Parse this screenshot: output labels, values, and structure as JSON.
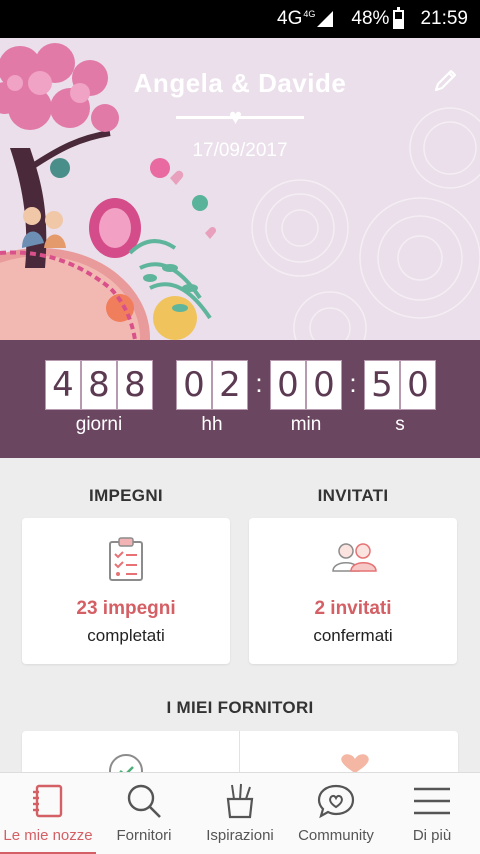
{
  "status_bar": {
    "network": "4G",
    "network_sup": "4G",
    "battery": "48%",
    "time": "21:59"
  },
  "hero": {
    "names": "Angela & Davide",
    "date": "17/09/2017",
    "edit_icon": "pencil-icon",
    "heart_icon": "heart-icon"
  },
  "countdown": {
    "days": [
      "4",
      "8",
      "8"
    ],
    "hours": [
      "0",
      "2"
    ],
    "minutes": [
      "0",
      "0"
    ],
    "seconds": [
      "5",
      "0"
    ],
    "labels": {
      "days": "giorni",
      "hours": "hh",
      "minutes": "min",
      "seconds": "s"
    }
  },
  "tasks": {
    "title": "IMPEGNI",
    "count": "23 impegni",
    "subtitle": "completati",
    "icon": "clipboard-checklist-icon"
  },
  "guests": {
    "title": "INVITATI",
    "count": "2 invitati",
    "subtitle": "confermati",
    "icon": "couple-icon"
  },
  "vendors": {
    "title": "I MIEI FORNITORI"
  },
  "nav": {
    "items": [
      {
        "label": "Le mie nozze",
        "icon": "notebook-icon"
      },
      {
        "label": "Fornitori",
        "icon": "search-icon"
      },
      {
        "label": "Ispirazioni",
        "icon": "pencil-cup-icon"
      },
      {
        "label": "Community",
        "icon": "chat-heart-icon"
      },
      {
        "label": "Di più",
        "icon": "menu-icon"
      }
    ]
  },
  "colors": {
    "accent": "#d45f64",
    "countdown_bg": "#6b4660",
    "hero_bg": "#eadfea",
    "background": "#ededed"
  }
}
